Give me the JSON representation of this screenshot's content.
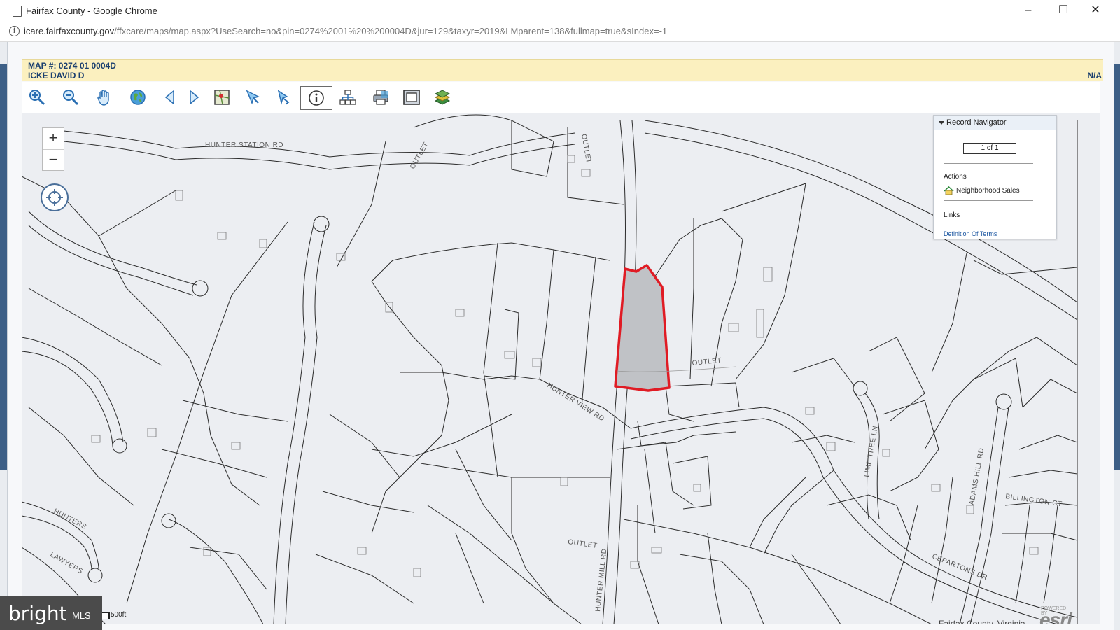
{
  "window": {
    "title": "Fairfax County - Google Chrome",
    "minimize": "–",
    "maximize": "☐",
    "close": "✕"
  },
  "address": {
    "host": "icare.fairfaxcounty.gov",
    "path": "/ffxcare/maps/map.aspx?UseSearch=no&pin=0274%2001%20%200004D&jur=129&taxyr=2019&LMparent=138&fullmap=true&sIndex=-1"
  },
  "parcel": {
    "map_number": "MAP #: 0274 01 0004D",
    "owner": "ICKE DAVID D",
    "status": "N/A",
    "highlight_color": "#e01b24",
    "highlight_fill": "#c0c2c6"
  },
  "toolbar": {
    "tools": [
      "zoom-in-icon",
      "zoom-out-icon",
      "pan-hand-icon",
      "full-extent-globe-icon",
      "previous-extent-icon",
      "next-extent-icon",
      "map-select-icon",
      "select-arrow-icon",
      "measure-icon",
      "identify-info-icon",
      "buffer-icon",
      "print-icon",
      "zoom-to-window-icon",
      "layers-icon"
    ],
    "active_tool": "identify-info-icon"
  },
  "map_controls": {
    "zoom_in": "+",
    "zoom_out": "−"
  },
  "navigator": {
    "title": "Record Navigator",
    "counter": "1 of 1",
    "actions_label": "Actions",
    "action_item": "Neighborhood Sales",
    "links_label": "Links",
    "link_item": "Definition Of Terms"
  },
  "street_labels": {
    "hunter_station": "HUNTER STATION RD",
    "outlet_1": "OUTLET",
    "outlet_2": "OUTLET",
    "outlet_3": "OUTLET",
    "outlet_4": "OUTLET",
    "hunter_view": "HUNTER VIEW RD",
    "hunter_mill": "HUNTER MILL RD",
    "hunters": "HUNTERS",
    "lawyers": "LAWYERS",
    "lime_tree": "LIME TREE LN",
    "adams_hill": "ADAMS HILL RD",
    "billington": "BILLINGTON CT",
    "ceparon": "CEPARTONS DR"
  },
  "scale": {
    "label": "500ft"
  },
  "credits": {
    "county": "Fairfax County, Virginia",
    "powered": "POWERED BY",
    "esri": "esri"
  },
  "watermark": {
    "brand": "bright",
    "suffix": "MLS"
  }
}
